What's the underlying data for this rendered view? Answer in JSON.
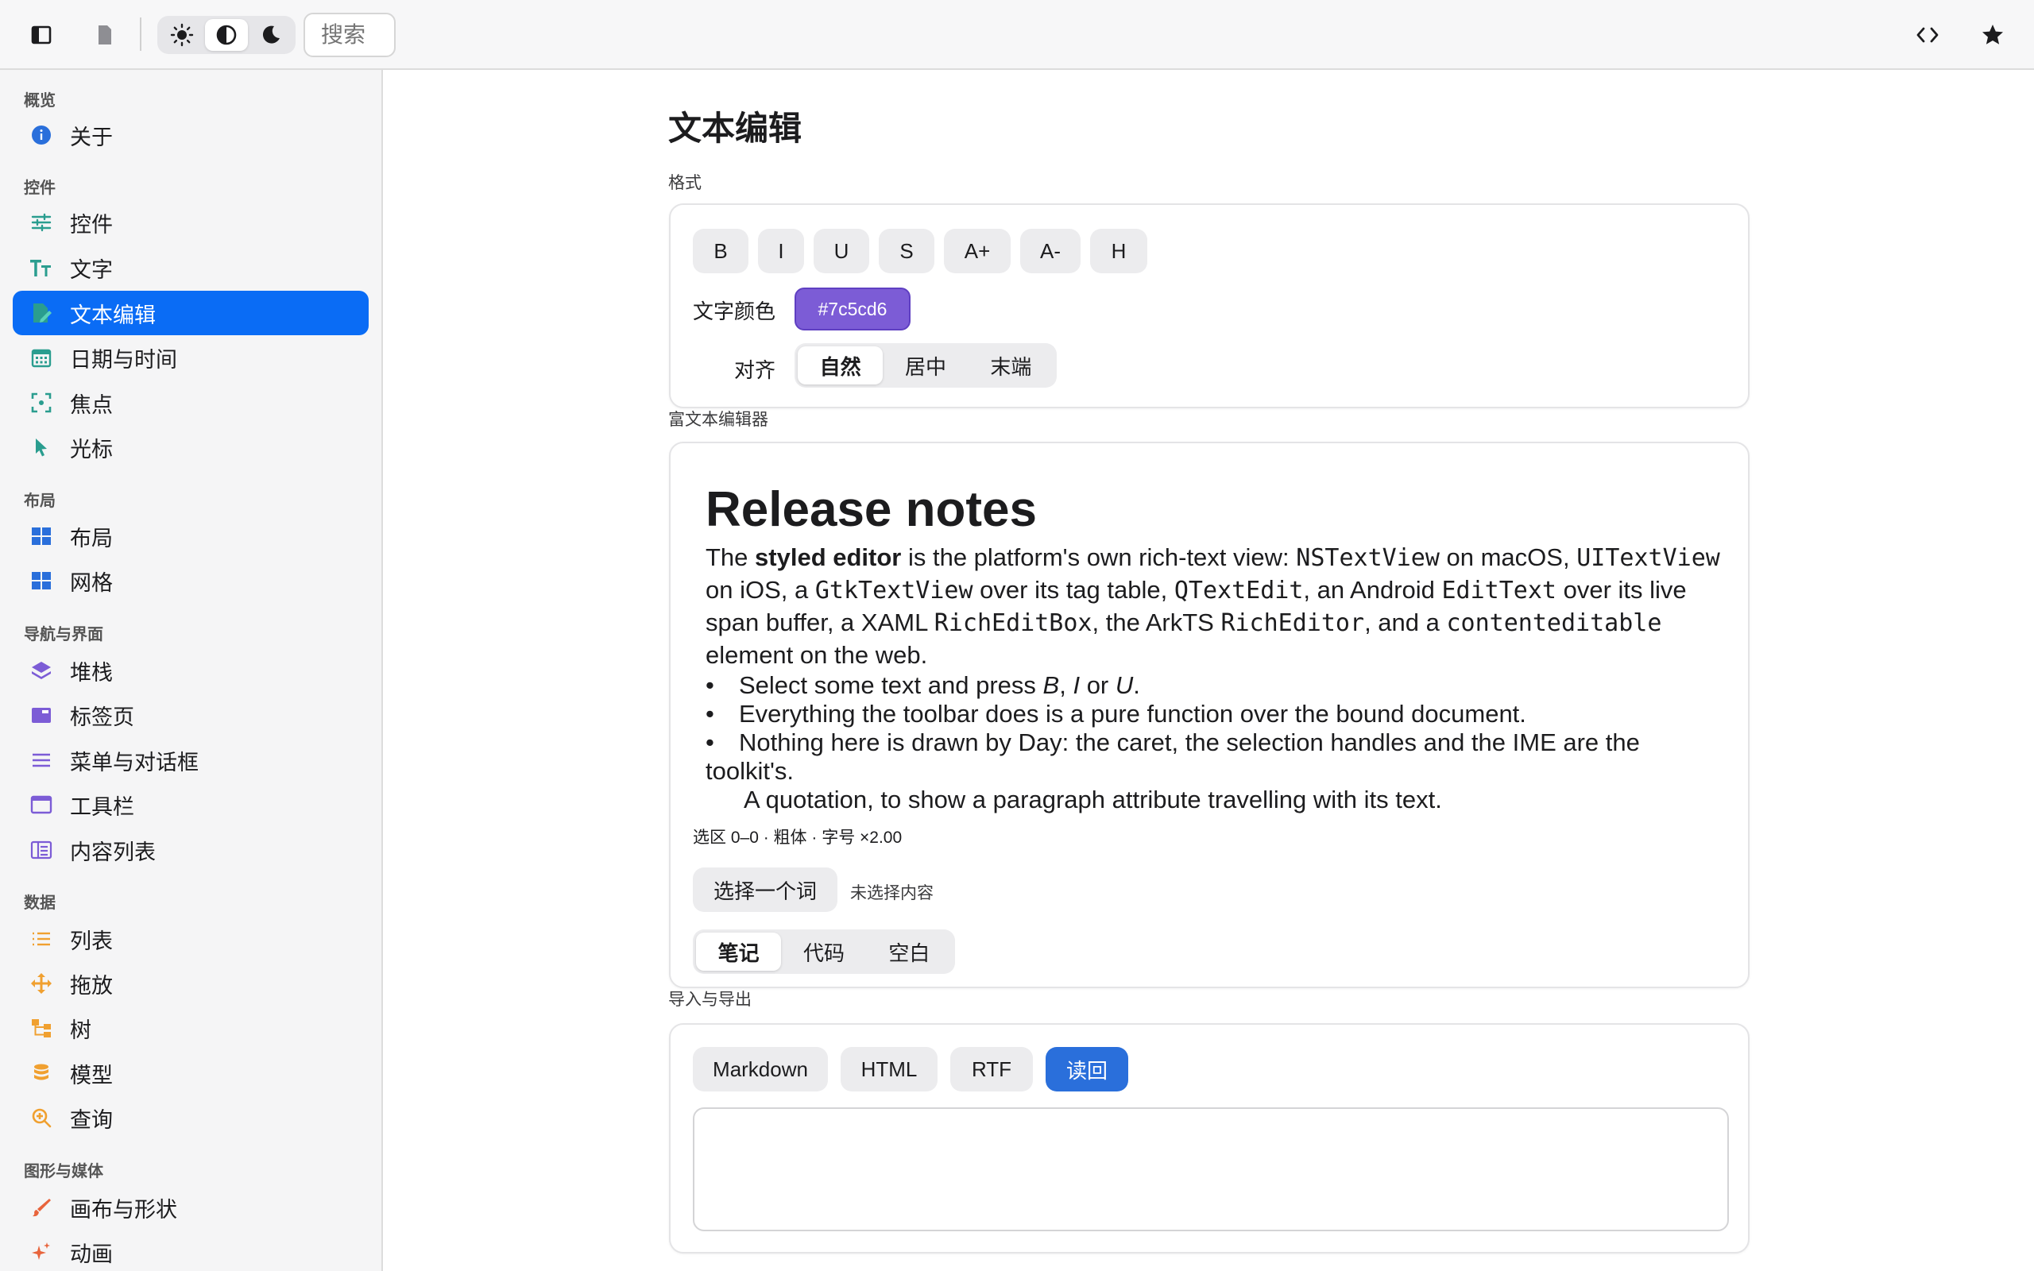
{
  "toolbar": {
    "search_placeholder": "搜索",
    "icons": [
      "sidebar-toggle-icon",
      "document-icon",
      "sun-icon",
      "contrast-icon",
      "moon-icon",
      "code-icon",
      "star-icon"
    ]
  },
  "sidebar": {
    "sections": [
      {
        "label": "概览",
        "items": [
          {
            "label": "关于",
            "icon": "info-icon"
          }
        ]
      },
      {
        "label": "控件",
        "items": [
          {
            "label": "控件",
            "icon": "sliders-icon"
          },
          {
            "label": "文字",
            "icon": "text-size-icon"
          },
          {
            "label": "文本编辑",
            "icon": "edit-document-icon",
            "selected": true
          },
          {
            "label": "日期与时间",
            "icon": "calendar-icon"
          },
          {
            "label": "焦点",
            "icon": "focus-icon"
          },
          {
            "label": "光标",
            "icon": "cursor-icon"
          }
        ]
      },
      {
        "label": "布局",
        "items": [
          {
            "label": "布局",
            "icon": "layout-icon"
          },
          {
            "label": "网格",
            "icon": "grid-icon"
          }
        ]
      },
      {
        "label": "导航与界面",
        "items": [
          {
            "label": "堆栈",
            "icon": "stack-icon"
          },
          {
            "label": "标签页",
            "icon": "tabs-icon"
          },
          {
            "label": "菜单与对话框",
            "icon": "menu-icon"
          },
          {
            "label": "工具栏",
            "icon": "window-icon"
          },
          {
            "label": "内容列表",
            "icon": "columns-icon"
          }
        ]
      },
      {
        "label": "数据",
        "items": [
          {
            "label": "列表",
            "icon": "list-icon"
          },
          {
            "label": "拖放",
            "icon": "move-icon"
          },
          {
            "label": "树",
            "icon": "tree-icon"
          },
          {
            "label": "模型",
            "icon": "database-icon"
          },
          {
            "label": "查询",
            "icon": "search-zoom-icon"
          }
        ]
      },
      {
        "label": "图形与媒体",
        "items": [
          {
            "label": "画布与形状",
            "icon": "brush-icon"
          },
          {
            "label": "动画",
            "icon": "sparkles-icon"
          }
        ]
      }
    ]
  },
  "main": {
    "title": "文本编辑",
    "format": {
      "label": "格式",
      "buttons": [
        "B",
        "I",
        "U",
        "S",
        "A+",
        "A-",
        "H"
      ],
      "text_color_label": "文字颜色",
      "text_color_value": "#7c5cd6",
      "align_label": "对齐",
      "align_options": [
        "自然",
        "居中",
        "末端"
      ],
      "align_selected": "自然"
    },
    "rich": {
      "label": "富文本编辑器",
      "heading": "Release notes",
      "p_the": "The ",
      "p_styled": "styled editor",
      "p_t1": " is the platform's own rich-text view: ",
      "c1": "NSTextView",
      "p_t2": " on macOS, ",
      "c2": "UITextView",
      "p_t3": " on iOS, a ",
      "c3": "GtkTextView",
      "p_t4": " over its tag table, ",
      "c4": "QTextEdit",
      "p_t5": ", an Android ",
      "c5": "EditText",
      "p_t6": " over its live span buffer, a XAML ",
      "c6": "RichEditBox",
      "p_t7": ", the ArkTS ",
      "c7": "RichEditor",
      "p_t8": ", and a ",
      "c8": "contenteditable",
      "p_t9": " element on the web.",
      "li1_a": "Select some text and press ",
      "li1_b": "B",
      "li1_c": ", ",
      "li1_d": "I",
      "li1_e": " or ",
      "li1_f": "U",
      "li1_g": ".",
      "li2": "Everything the toolbar does is a pure function over the bound document.",
      "li3": "Nothing here is drawn by Day: the caret, the selection handles and the IME are the toolkit's.",
      "quote": "A quotation, to show a paragraph attribute travelling with its text.",
      "status": "选区 0–0 · 粗体 · 字号 ×2.00",
      "select_word": "选择一个词",
      "selection_hint": "未选择内容",
      "presets": [
        "笔记",
        "代码",
        "空白"
      ],
      "preset_selected": "笔记"
    },
    "io": {
      "label": "导入与导出",
      "buttons": [
        "Markdown",
        "HTML",
        "RTF"
      ],
      "readback": "读回",
      "output": ""
    }
  }
}
